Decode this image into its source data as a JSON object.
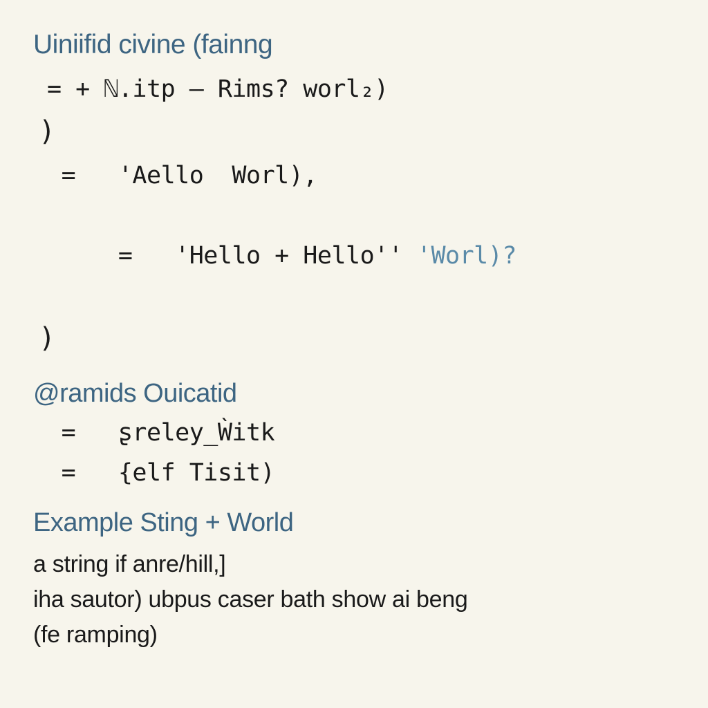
{
  "section1": {
    "heading": "Uiniifid civine (fainng",
    "line1": "= + ℕ.itp – Rims? worl₂)",
    "close1": ")",
    "line2": " =   'Aello  Worl),",
    "line3_a": " =   'Hello + Hello'' ",
    "line3_accent": "'Worl)?",
    "close2": ")"
  },
  "section2": {
    "heading": "@ramids Ouicatid",
    "line1": " =   ʂreley_Ẁitk",
    "line2": " =   {elf Tisit)"
  },
  "section3": {
    "heading": "Example Sting + World",
    "line1": "a string if anre/hill,]",
    "line2": "iha sautor) ubpus caser bath show ai beng",
    "line3": "(fe ramping)"
  }
}
